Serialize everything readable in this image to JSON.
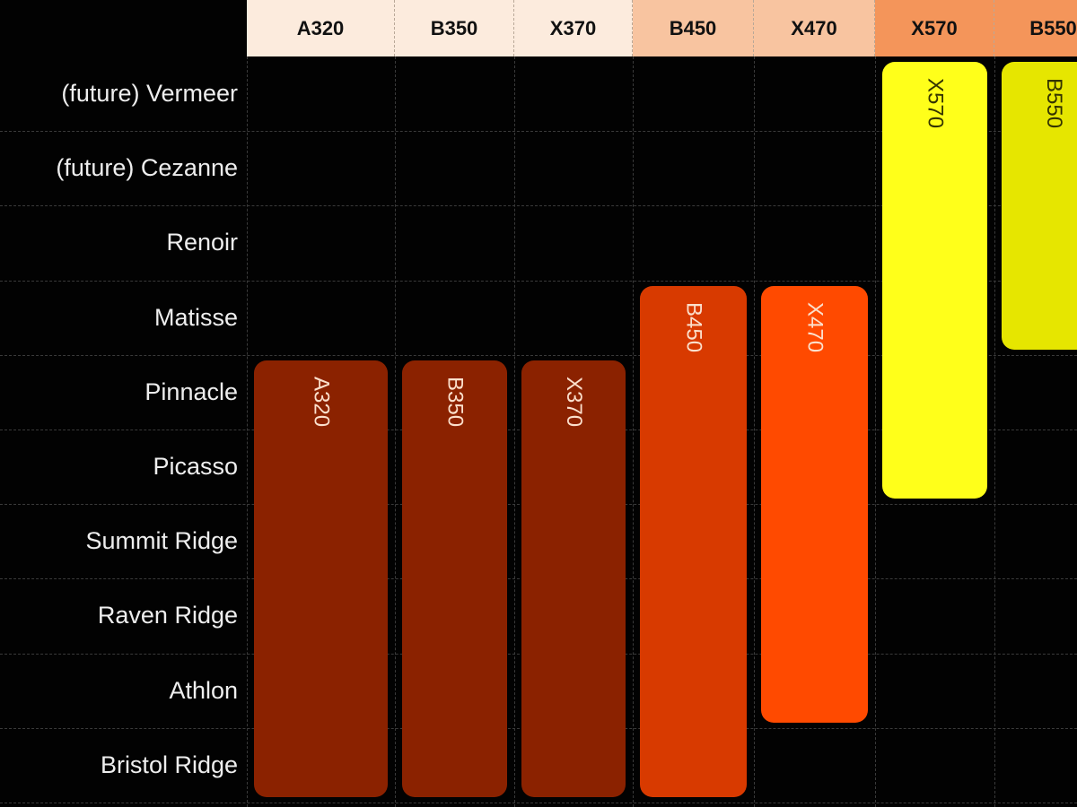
{
  "columns": [
    {
      "label": "A320",
      "header_color": "#FCEBDD"
    },
    {
      "label": "B350",
      "header_color": "#FCEBDD"
    },
    {
      "label": "X370",
      "header_color": "#FCEBDD"
    },
    {
      "label": "B450",
      "header_color": "#F8C4A0"
    },
    {
      "label": "X470",
      "header_color": "#F8C4A0"
    },
    {
      "label": "X570",
      "header_color": "#F4955A"
    },
    {
      "label": "B550",
      "header_color": "#F4955A"
    }
  ],
  "rows": [
    "(future) Vermeer",
    "(future) Cezanne",
    "Renoir",
    "Matisse",
    "Pinnacle",
    "Picasso",
    "Summit Ridge",
    "Raven Ridge",
    "Athlon",
    "Bristol Ridge"
  ],
  "bars": [
    {
      "label": "A320",
      "column": "A320",
      "from": "Pinnacle",
      "to": "Bristol Ridge",
      "color": "#8B2200",
      "text_color": "#FBE0CC"
    },
    {
      "label": "B350",
      "column": "B350",
      "from": "Pinnacle",
      "to": "Bristol Ridge",
      "color": "#8B2200",
      "text_color": "#FBE0CC"
    },
    {
      "label": "X370",
      "column": "X370",
      "from": "Pinnacle",
      "to": "Bristol Ridge",
      "color": "#8B2200",
      "text_color": "#FBE0CC"
    },
    {
      "label": "B450",
      "column": "B450",
      "from": "Matisse",
      "to": "Bristol Ridge",
      "color": "#D83A00",
      "text_color": "#FBE0CC"
    },
    {
      "label": "X470",
      "column": "X470",
      "from": "Matisse",
      "to": "Athlon",
      "color": "#FF4A00",
      "text_color": "#FBE0CC"
    },
    {
      "label": "X570",
      "column": "X570",
      "from": "(future) Vermeer",
      "to": "Picasso",
      "color": "#FFFF1A",
      "text_color": "#333300"
    },
    {
      "label": "B550",
      "column": "B550",
      "from": "(future) Vermeer",
      "to": "Matisse",
      "color": "#E6E600",
      "text_color": "#333300"
    }
  ]
}
